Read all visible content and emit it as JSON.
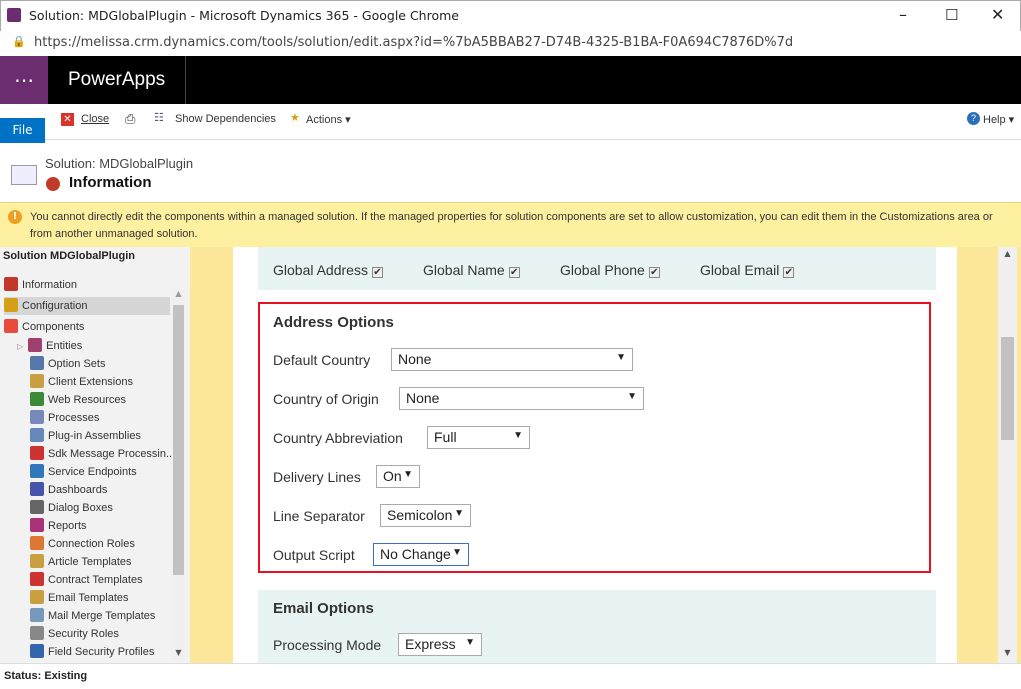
{
  "window": {
    "title": "Solution: MDGlobalPlugin - Microsoft Dynamics 365 - Google Chrome",
    "url": "https://melissa.crm.dynamics.com/tools/solution/edit.aspx?id=%7bA5BBAB27-D74B-4325-B1BA-F0A694C7876D%7d"
  },
  "app": {
    "name": "PowerApps"
  },
  "toolbar": {
    "file": "File",
    "close": "Close",
    "show_dependencies": "Show Dependencies",
    "actions": "Actions",
    "help": "Help"
  },
  "header": {
    "solution": "Solution: MDGlobalPlugin",
    "title": "Information"
  },
  "warning": "You cannot directly edit the components within a managed solution. If the managed properties for solution components are set to allow customization, you can edit them in the Customizations area or from another unmanaged solution.",
  "sidebar": {
    "title": "Solution MDGlobalPlugin",
    "top": [
      {
        "label": "Information",
        "color": "#c0392b"
      },
      {
        "label": "Configuration",
        "color": "#d4a017"
      },
      {
        "label": "Components",
        "color": "#e74c3c"
      }
    ],
    "items": [
      {
        "label": "Entities",
        "color": "#a04070"
      },
      {
        "label": "Option Sets",
        "color": "#5577aa"
      },
      {
        "label": "Client Extensions",
        "color": "#c8a040"
      },
      {
        "label": "Web Resources",
        "color": "#3a8a3a"
      },
      {
        "label": "Processes",
        "color": "#7788bb"
      },
      {
        "label": "Plug-in Assemblies",
        "color": "#6688bb"
      },
      {
        "label": "Sdk Message Processin...",
        "color": "#cc3333"
      },
      {
        "label": "Service Endpoints",
        "color": "#3377bb"
      },
      {
        "label": "Dashboards",
        "color": "#4455aa"
      },
      {
        "label": "Dialog Boxes",
        "color": "#666666"
      },
      {
        "label": "Reports",
        "color": "#aa3377"
      },
      {
        "label": "Connection Roles",
        "color": "#dd7733"
      },
      {
        "label": "Article Templates",
        "color": "#c8a040"
      },
      {
        "label": "Contract Templates",
        "color": "#cc3333"
      },
      {
        "label": "Email Templates",
        "color": "#c8a040"
      },
      {
        "label": "Mail Merge Templates",
        "color": "#7799bb"
      },
      {
        "label": "Security Roles",
        "color": "#888888"
      },
      {
        "label": "Field Security Profiles",
        "color": "#3366aa"
      }
    ]
  },
  "globals": [
    {
      "label": "Global Address",
      "checked": true
    },
    {
      "label": "Global Name",
      "checked": true
    },
    {
      "label": "Global Phone",
      "checked": true
    },
    {
      "label": "Global Email",
      "checked": true
    }
  ],
  "address": {
    "title": "Address Options",
    "fields": [
      {
        "label": "Default Country",
        "value": "None"
      },
      {
        "label": "Country of Origin",
        "value": "None"
      },
      {
        "label": "Country Abbreviation",
        "value": "Full"
      },
      {
        "label": "Delivery Lines",
        "value": "On"
      },
      {
        "label": "Line Separator",
        "value": "Semicolon"
      },
      {
        "label": "Output Script",
        "value": "No Change"
      }
    ]
  },
  "email": {
    "title": "Email Options",
    "fields": [
      {
        "label": "Processing Mode",
        "value": "Express"
      }
    ]
  },
  "status": "Status: Existing",
  "colors": {
    "highlight": "#e81123",
    "brand": "#6b2d6f",
    "file": "#0072c6"
  }
}
